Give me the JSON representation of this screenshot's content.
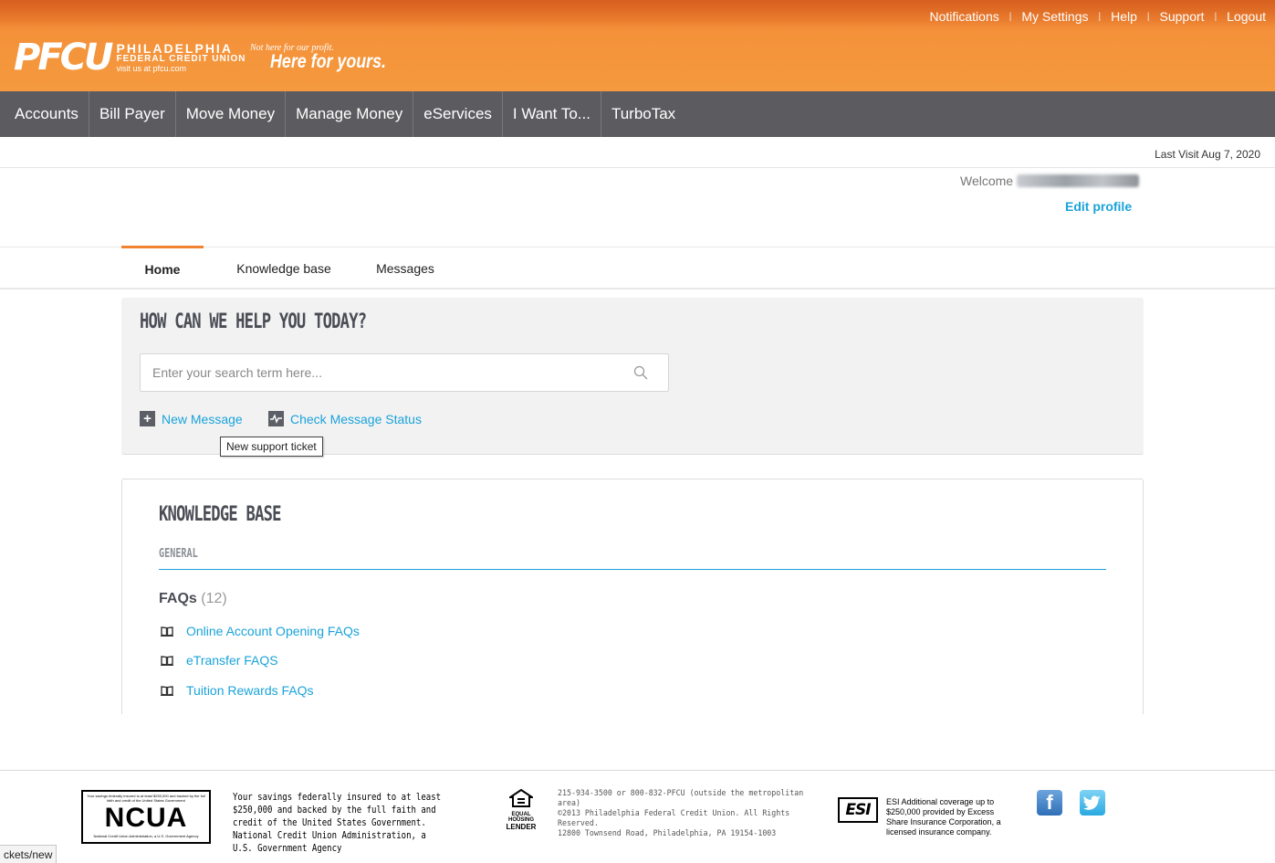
{
  "top_links": [
    "Notifications",
    "My Settings",
    "Help",
    "Support",
    "Logout"
  ],
  "brand": {
    "mark": "PFCU",
    "line1": "PHILADELPHIA",
    "line2": "FEDERAL CREDIT UNION",
    "line3": "visit us at pfcu.com",
    "tagline_small": "Not here for our profit.",
    "tagline_big": "Here for yours."
  },
  "nav": [
    "Accounts",
    "Bill Payer",
    "Move Money",
    "Manage Money",
    "eServices",
    "I Want To...",
    "TurboTax"
  ],
  "last_visit": "Last Visit Aug 7, 2020",
  "welcome": {
    "label": "Welcome",
    "edit_profile": "Edit profile"
  },
  "tabs": [
    {
      "label": "Home",
      "active": true
    },
    {
      "label": "Knowledge base",
      "active": false
    },
    {
      "label": "Messages",
      "active": false
    }
  ],
  "help": {
    "title": "HOW CAN WE HELP YOU TODAY?",
    "search_placeholder": "Enter your search term here...",
    "new_message": "New Message",
    "check_status": "Check Message Status",
    "tooltip": "New support ticket"
  },
  "kb": {
    "title": "KNOWLEDGE BASE",
    "section": "GENERAL",
    "category": "FAQs",
    "count": "(12)",
    "items": [
      "Online Account Opening FAQs",
      "eTransfer FAQS",
      "Tuition Rewards FAQs"
    ]
  },
  "footer": {
    "ncua_small_top": "Your savings federally insured to at least $250,000 and backed by the full faith and credit of the United States Government",
    "ncua_big": "NCUA",
    "ncua_small_bottom": "National Credit Union Administration, a U.S. Government Agency",
    "insured_text": "Your savings federally insured to at least $250,000 and backed by the full faith and credit of the United States Government. National Credit Union Administration, a U.S. Government Agency",
    "ehl_line1": "EQUAL HOUSING",
    "ehl_line2": "LENDER",
    "contact_line1": "215-934-3500 or 800-832-PFCU (outside the metropolitan area)",
    "contact_line2": "©2013 Philadelphia Federal Credit Union. All Rights Reserved.",
    "contact_line3": "12800 Townsend Road, Philadelphia, PA 19154-1003",
    "esi_logo": "ESI",
    "esi_text": "ESI Additional coverage up to $250,000 provided by Excess Share Insurance Corporation, a licensed insurance company."
  },
  "statusbar": "ckets/new",
  "colors": {
    "orange": "#f4913a",
    "nav": "#5c5c60",
    "link": "#1aa3d9",
    "accent": "#f08232"
  }
}
